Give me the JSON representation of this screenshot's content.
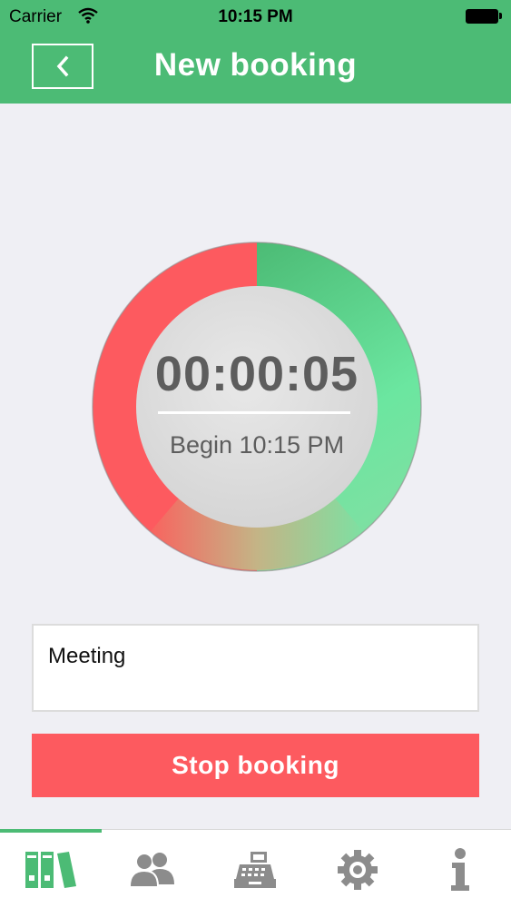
{
  "status_bar": {
    "carrier": "Carrier",
    "time": "10:15 PM"
  },
  "header": {
    "title": "New booking"
  },
  "timer": {
    "elapsed": "00:00:05",
    "begin_label": "Begin 10:15 PM",
    "ring_colors": {
      "start": "#4cbb75",
      "mid": "#6be6a0",
      "end": "#fd5a5f"
    }
  },
  "note": {
    "value": "Meeting"
  },
  "stop_button": {
    "label": "Stop booking"
  },
  "tabbar": {
    "active": "bookings",
    "items": [
      {
        "id": "bookings",
        "icon": "binders-icon"
      },
      {
        "id": "people",
        "icon": "people-icon"
      },
      {
        "id": "register",
        "icon": "cash-register-icon"
      },
      {
        "id": "settings",
        "icon": "gear-icon"
      },
      {
        "id": "info",
        "icon": "info-icon"
      }
    ]
  },
  "colors": {
    "accent": "#4cbb75",
    "danger": "#fd5a5f",
    "background": "#efeff4",
    "text": "#5d5d5d"
  }
}
